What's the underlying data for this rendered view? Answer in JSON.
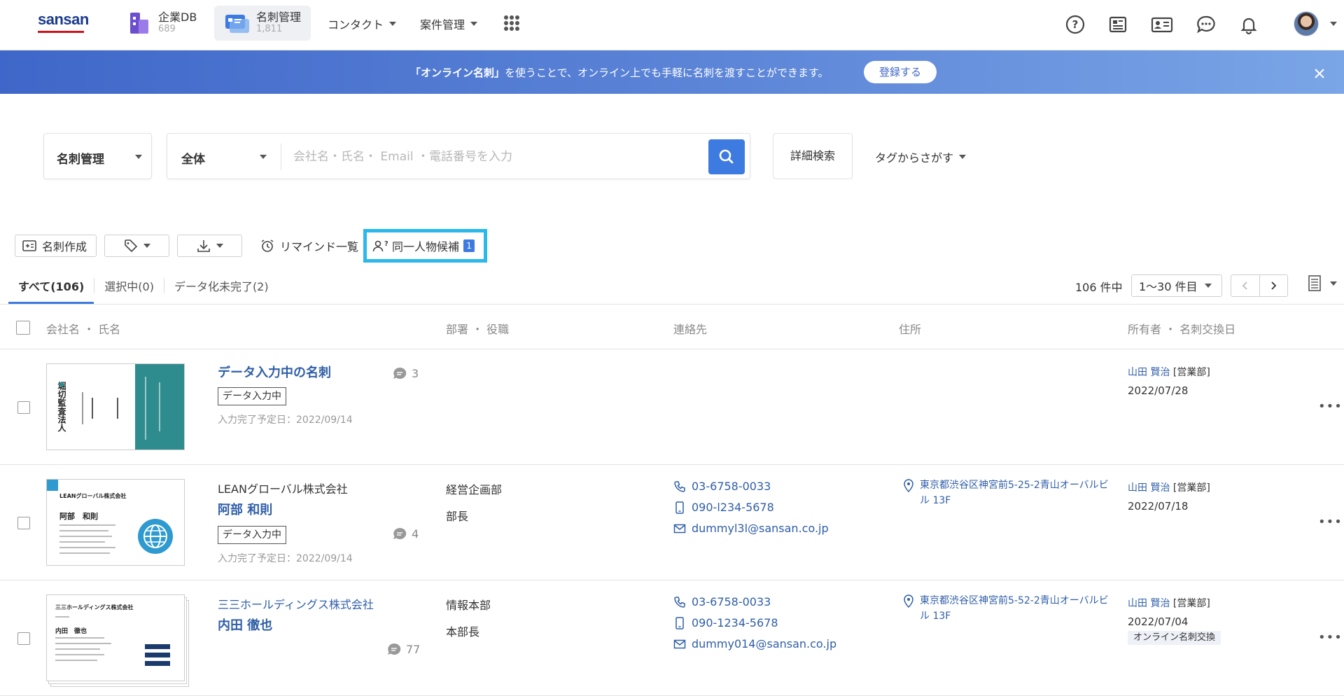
{
  "nav": {
    "logo": "sansan",
    "apps": [
      {
        "name": "企業DB",
        "count": "689"
      },
      {
        "name": "名刺管理",
        "count": "1,811"
      }
    ],
    "menus": [
      "コンタクト",
      "案件管理"
    ]
  },
  "banner": {
    "text_bold": "「オンライン名刺」",
    "text_rest": "を使うことで、オンライン上でも手軽に名刺を渡すことができます。",
    "button": "登録する"
  },
  "search": {
    "scope": "名刺管理",
    "filter": "全体",
    "placeholder": "会社名・氏名・ Email ・電話番号を入力",
    "advanced": "詳細検索",
    "tag_search": "タグからさがす"
  },
  "toolbar": {
    "create": "名刺作成",
    "remind": "リマインド一覧",
    "duplicate": "同一人物候補",
    "duplicate_count": "1"
  },
  "tabs": [
    "すべて(106)",
    "選択中(0)",
    "データ化未完了(2)"
  ],
  "pagination": {
    "total": "106 件中",
    "range": "1〜30 件目"
  },
  "columns": [
    "会社名 ・ 氏名",
    "部署 ・ 役職",
    "連絡先",
    "住所",
    "所有者 ・ 名刺交換日"
  ],
  "rows": [
    {
      "name": "データ入力中の名刺",
      "status": "データ入力中",
      "eta": "入力完了予定日：2022/09/14",
      "comments": "3",
      "owner": "山田 賢治",
      "owner_dept": "[営業部]",
      "date": "2022/07/28",
      "card_text": "堀切監査法人"
    },
    {
      "company": "LEANグローバル株式会社",
      "name": "阿部 和則",
      "status": "データ入力中",
      "eta": "入力完了予定日：2022/09/14",
      "comments": "4",
      "dept": "経営企画部",
      "title": "部長",
      "phone": "03-6758-0033",
      "mobile": "090-l234-5678",
      "email": "dummyl3l@sansan.co.jp",
      "address": "東京都渋谷区神宮前5-25-2青山オーバルビル 13F",
      "owner": "山田 賢治",
      "owner_dept": "[営業部]",
      "date": "2022/07/18",
      "card_company": "LEANグローバル株式会社",
      "card_name": "阿部　和則"
    },
    {
      "company": "三三ホールディングス株式会社",
      "name": "内田 徹也",
      "comments": "77",
      "dept": "情報本部",
      "title": "本部長",
      "phone": "03-6758-0033",
      "mobile": "090-1234-5678",
      "email": "dummy014@sansan.co.jp",
      "address": "東京都渋谷区神宮前5-52-2青山オーバルビル 13F",
      "owner": "山田 賢治",
      "owner_dept": "[営業部]",
      "date": "2022/07/04",
      "exchange_tag": "オンライン名刺交換",
      "card_company": "三三ホールディングス株式会社",
      "card_name": "内田　徹也"
    }
  ],
  "colors": {
    "brand": "#1b3b8c",
    "accent": "#3d7be0",
    "link": "#2f5ea8",
    "highlight": "#2bb8ea"
  }
}
